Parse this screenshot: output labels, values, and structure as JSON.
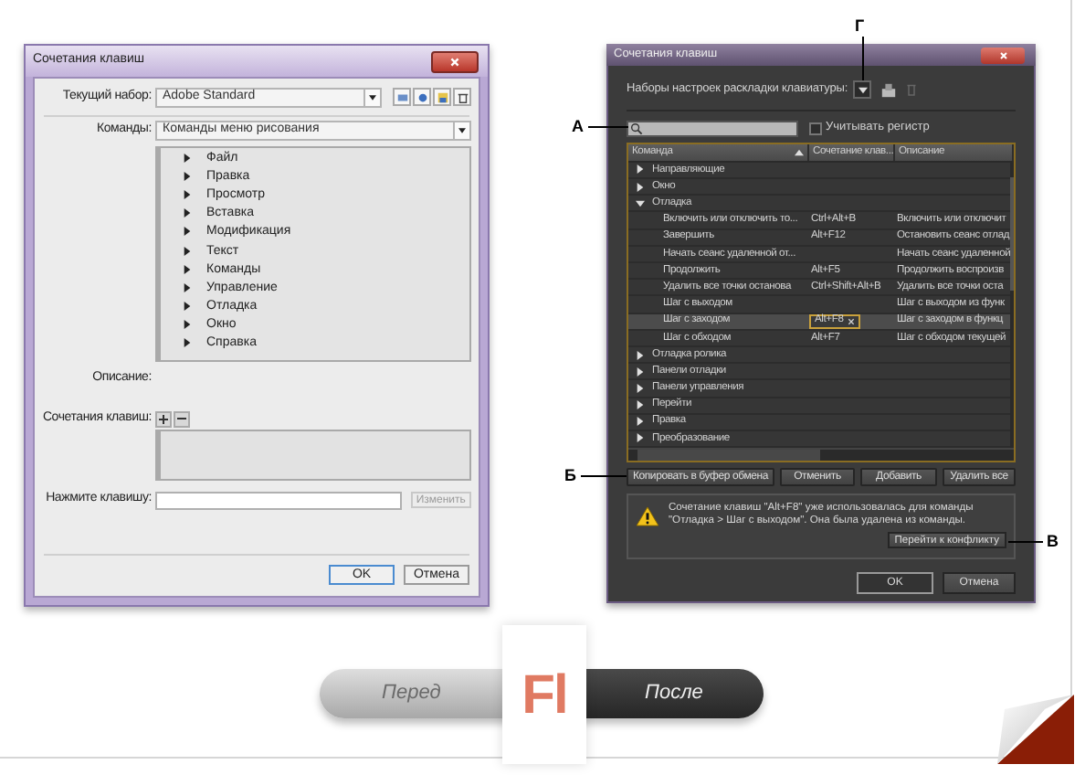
{
  "before_dialog": {
    "title": "Сочетания клавиш",
    "current_set": {
      "label": "Текущий набор:",
      "value": "Adobe Standard"
    },
    "commands": {
      "label": "Команды:",
      "value": "Команды меню рисования"
    },
    "menu_tree": [
      {
        "label": "Файл",
        "expanded": false
      },
      {
        "label": "Правка",
        "expanded": false
      },
      {
        "label": "Просмотр",
        "expanded": false
      },
      {
        "label": "Вставка",
        "expanded": false
      },
      {
        "label": "Модификация",
        "expanded": false
      },
      {
        "label": "Текст",
        "expanded": false
      },
      {
        "label": "Команды",
        "expanded": false
      },
      {
        "label": "Управление",
        "expanded": false
      },
      {
        "label": "Отладка",
        "expanded": false
      },
      {
        "label": "Окно",
        "expanded": false
      },
      {
        "label": "Справка",
        "expanded": false
      }
    ],
    "description_label": "Описание:",
    "shortcuts_label": "Сочетания клавиш:",
    "press_key": {
      "label": "Нажмите клавишу:",
      "button": "Изменить",
      "disabled": true
    },
    "ok_button": "OK",
    "cancel_button": "Отмена"
  },
  "after_dialog": {
    "title": "Сочетания клавиш",
    "presets_label": "Наборы настроек раскладки клавиатуры:",
    "case_checkbox": {
      "label": "Учитывать регистр",
      "checked": false
    },
    "table": {
      "columns": [
        "Команда",
        "Сочетание клав...",
        "Описание"
      ],
      "rows": [
        {
          "label": "Направляющие",
          "expanded": false,
          "selected": false
        },
        {
          "label": "Окно",
          "expanded": false,
          "selected": false
        },
        {
          "label": "Отладка",
          "expanded": true,
          "selected": false,
          "children": [
            {
              "command": "Включить или отключить то...",
              "shortcut": "Ctrl+Alt+B",
              "description": "Включить или отключит",
              "selected": false
            },
            {
              "command": "Завершить",
              "shortcut": "Alt+F12",
              "description": "Остановить сеанс отлад",
              "selected": false
            },
            {
              "command": "Начать сеанс удаленной от...",
              "description": "Начать сеанс удаленной",
              "selected": false
            },
            {
              "command": "Продолжить",
              "shortcut": "Alt+F5",
              "description": "Продолжить воспроизв",
              "selected": false
            },
            {
              "command": "Удалить все точки останова",
              "shortcut": "Ctrl+Shift+Alt+B",
              "description": "Удалить все точки оста",
              "selected": false
            },
            {
              "command": "Шаг с выходом",
              "description": "Шаг с выходом из функ",
              "selected": false
            },
            {
              "command": "Шаг с заходом",
              "shortcut": "Alt+F8",
              "description": "Шаг с заходом в функц",
              "selected": true
            },
            {
              "command": "Шаг с обходом",
              "shortcut": "Alt+F7",
              "description": "Шаг с обходом текущей",
              "selected": false
            }
          ]
        },
        {
          "label": "Отладка ролика",
          "expanded": false,
          "selected": false
        },
        {
          "label": "Панели отладки",
          "expanded": false,
          "selected": false
        },
        {
          "label": "Панели управления",
          "expanded": false,
          "selected": false
        },
        {
          "label": "Перейти",
          "expanded": false,
          "selected": false
        },
        {
          "label": "Правка",
          "expanded": false,
          "selected": false
        },
        {
          "label": "Преобразование",
          "expanded": false,
          "selected": false
        }
      ]
    },
    "buttons": [
      "Копировать в буфер обмена",
      "Отменить",
      "Добавить",
      "Удалить все"
    ],
    "warning": {
      "message": "Сочетание клавиш \"Alt+F8\" уже использовалась для команды \"Отладка > Шаг с выходом\". Она была удалена из команды.",
      "button": "Перейти к конфликту"
    },
    "ok_button": "OK",
    "cancel_button": "Отмена"
  },
  "callouts": [
    {
      "label": "А"
    },
    {
      "label": "Б"
    },
    {
      "label": "В"
    },
    {
      "label": "Г"
    }
  ],
  "banner": {
    "before": "Перед",
    "logo": "Fl",
    "after": "После"
  }
}
